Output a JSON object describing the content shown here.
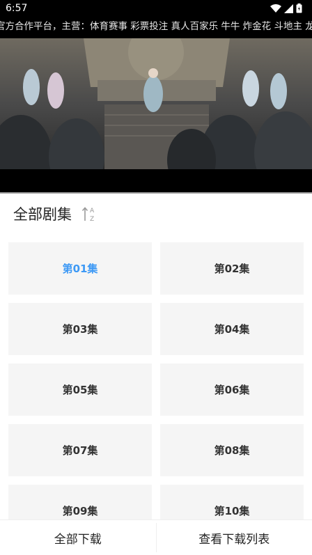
{
  "status_bar": {
    "time": "6:57",
    "icons": [
      "wifi-icon",
      "cellular-signal-icon",
      "battery-icon"
    ]
  },
  "marquee": {
    "text": "官方合作平台，主营：体育赛事 彩票投注 真人百家乐 牛牛 炸金花 斗地主 龙虎"
  },
  "episodes": {
    "title": "全部剧集",
    "sort_icon": "sort-az-icon",
    "selected_index": 0,
    "items": [
      "第01集",
      "第02集",
      "第03集",
      "第04集",
      "第05集",
      "第06集",
      "第07集",
      "第08集",
      "第09集",
      "第10集"
    ],
    "active_color": "#3d99f5"
  },
  "bottom_bar": {
    "download_all": "全部下载",
    "view_downloads": "查看下载列表"
  }
}
